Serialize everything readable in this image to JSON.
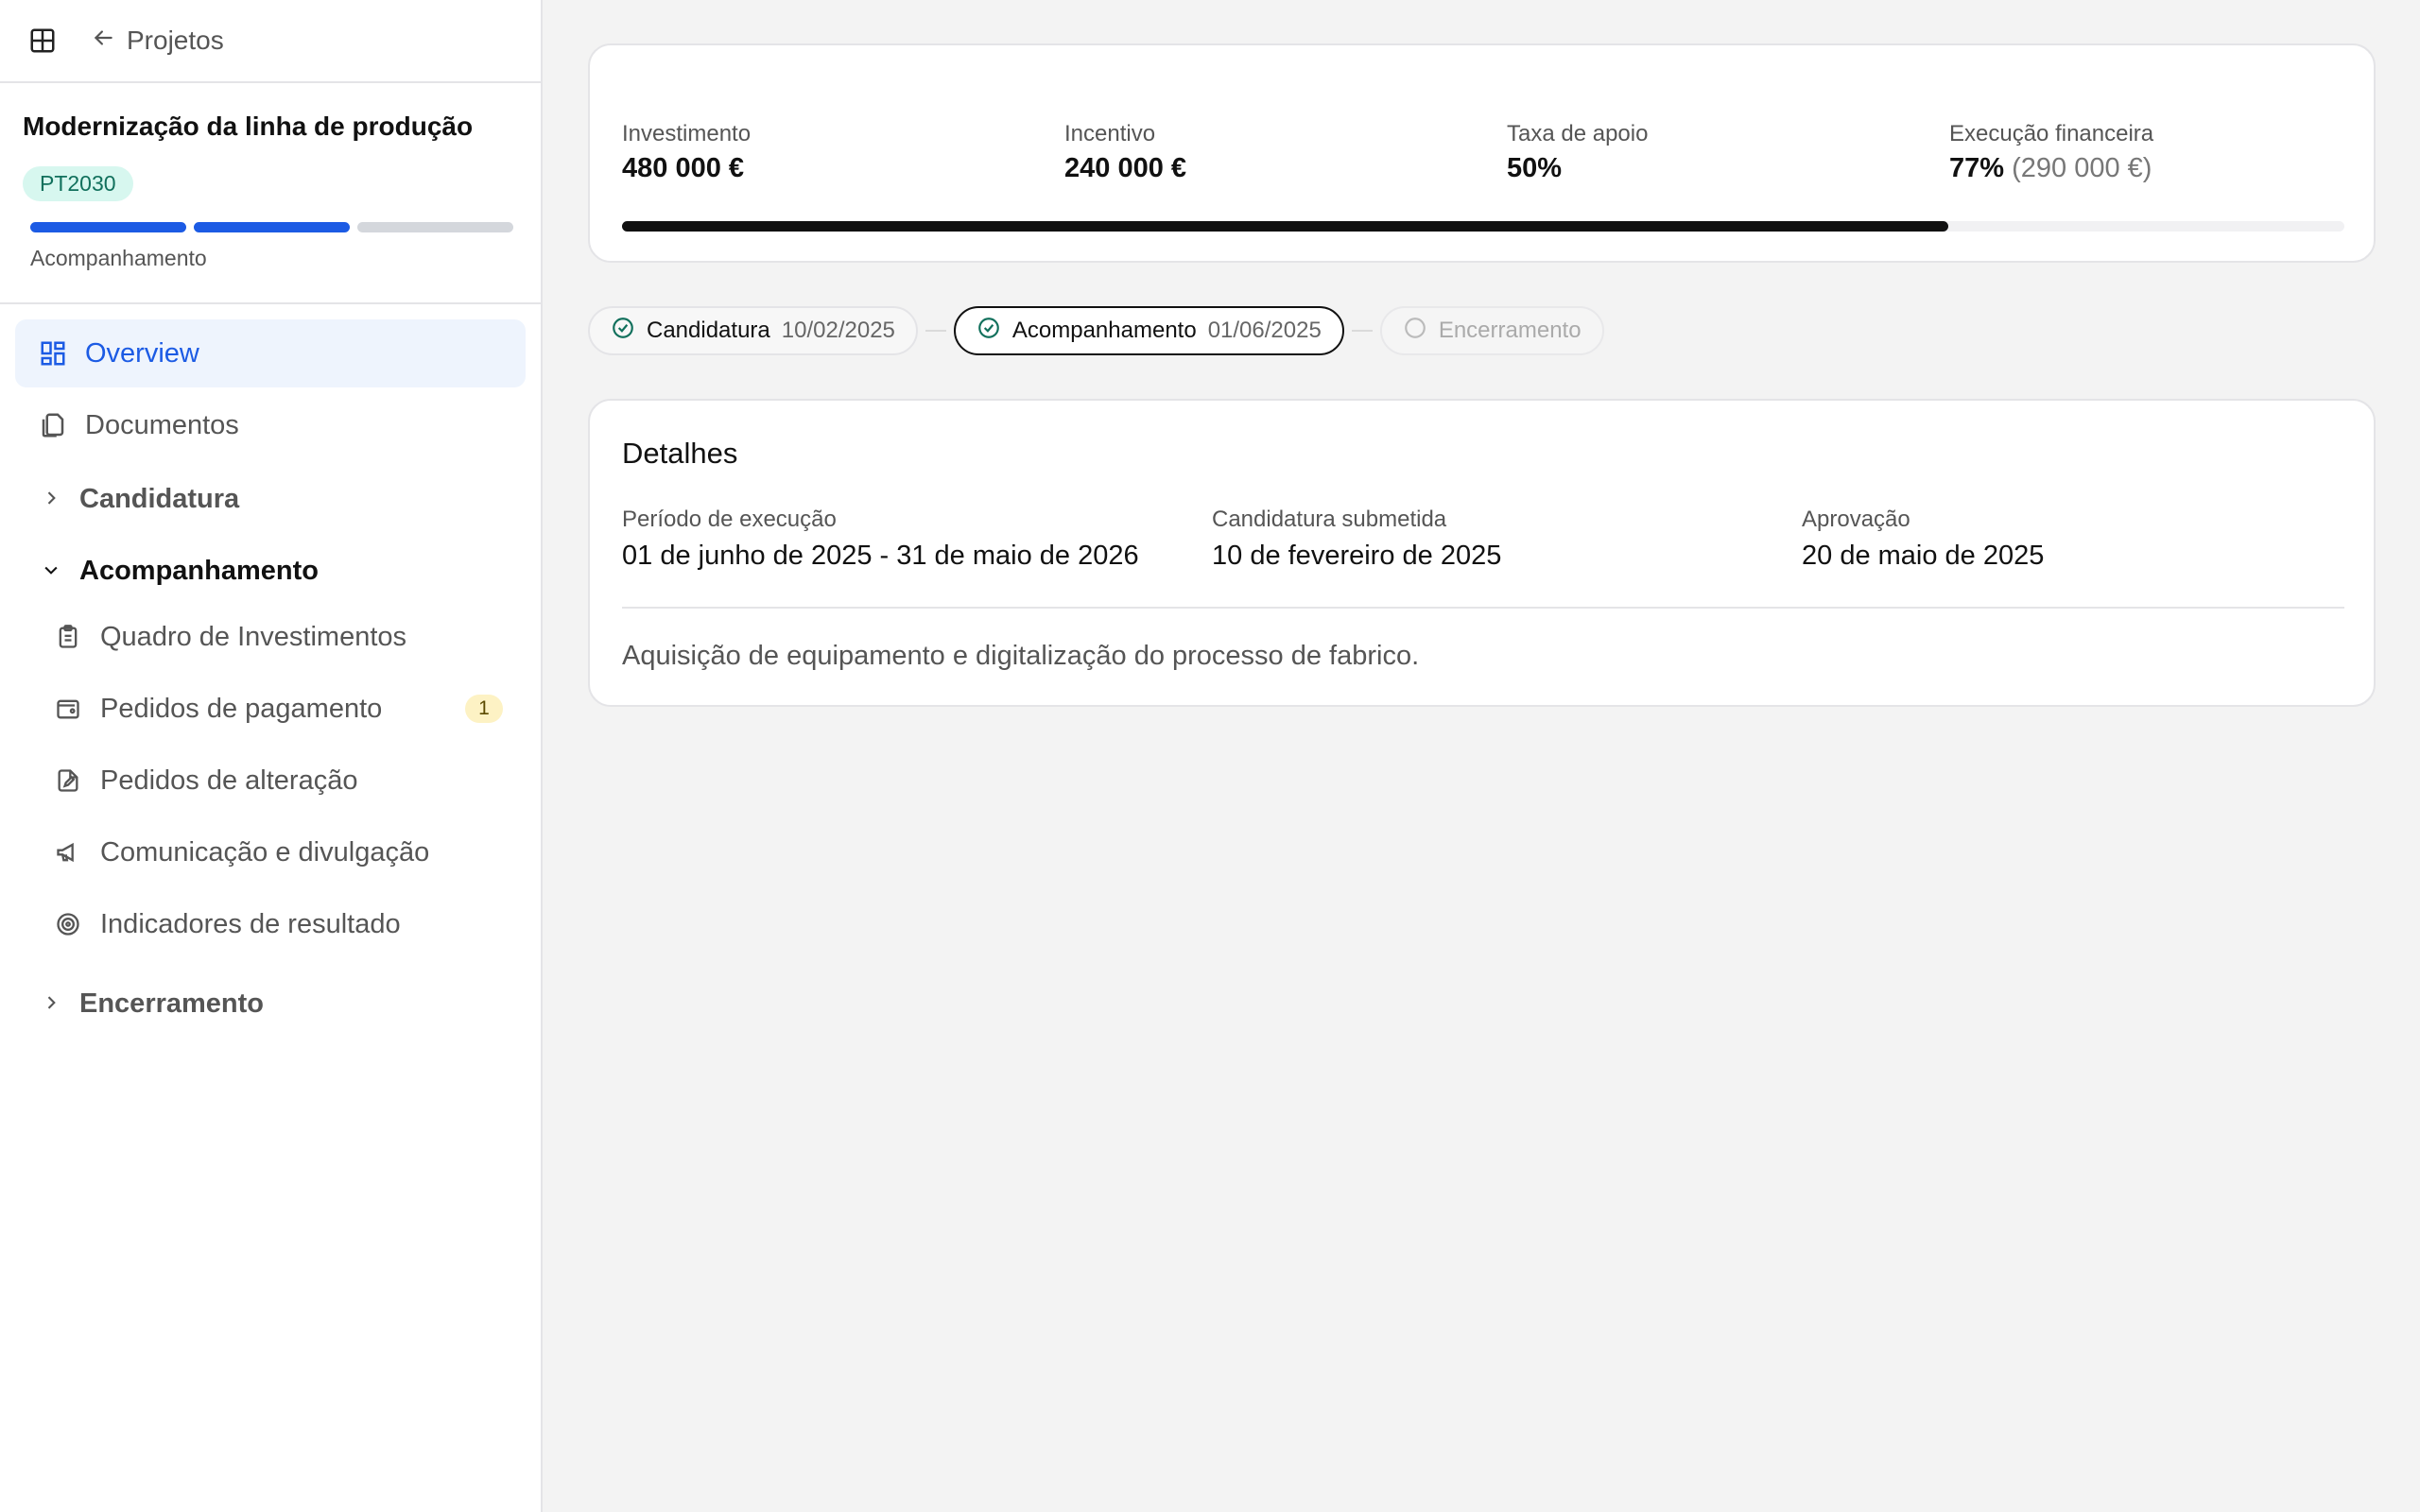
{
  "topbar": {
    "back_label": "Projetos",
    "grid_icon": "grid-icon",
    "back_icon": "arrow-left-icon"
  },
  "project": {
    "title": "Modernização da linha de produção",
    "tag": "PT2030",
    "phase_label": "Acompanhamento",
    "phases_total": 3,
    "phases_done": 2
  },
  "nav": {
    "overview": "Overview",
    "documents": "Documentos",
    "sections": {
      "candidatura": "Candidatura",
      "acompanhamento": "Acompanhamento",
      "encerramento": "Encerramento"
    },
    "sub_items": [
      {
        "label": "Quadro de Investimentos",
        "icon": "clipboard-icon"
      },
      {
        "label": "Pedidos de pagamento",
        "icon": "wallet-icon",
        "badge": "1"
      },
      {
        "label": "Pedidos de alteração",
        "icon": "file-edit-icon"
      },
      {
        "label": "Comunicação e divulgação",
        "icon": "megaphone-icon"
      },
      {
        "label": "Indicadores de resultado",
        "icon": "target-icon"
      }
    ]
  },
  "metrics": {
    "investimento": {
      "label": "Investimento",
      "value": "480 000 €"
    },
    "incentivo": {
      "label": "Incentivo",
      "value": "240 000 €"
    },
    "taxa": {
      "label": "Taxa de apoio",
      "value": "50%"
    },
    "execucao": {
      "label": "Execução financeira",
      "value": "77%",
      "sub": "(290 000 €)",
      "progress": 0.77
    }
  },
  "steps": [
    {
      "label": "Candidatura",
      "date": "10/02/2025",
      "status": "done"
    },
    {
      "label": "Acompanhamento",
      "date": "01/06/2025",
      "status": "current"
    },
    {
      "label": "Encerramento",
      "date": "",
      "status": "future"
    }
  ],
  "details": {
    "title": "Detalhes",
    "periodo_label": "Período de execução",
    "periodo_value": "01 de junho de 2025 - 31 de maio de 2026",
    "submetida_label": "Candidatura submetida",
    "submetida_value": "10 de fevereiro de 2025",
    "aprovacao_label": "Aprovação",
    "aprovacao_value": "20 de maio de 2025",
    "description": "Aquisição de equipamento e digitalização do processo de fabrico."
  },
  "colors": {
    "accent": "#1c5be4",
    "tag_bg": "#d7f7ef",
    "tag_text": "#11705c",
    "badge_bg": "#fdf2c4",
    "check": "#11705c"
  }
}
